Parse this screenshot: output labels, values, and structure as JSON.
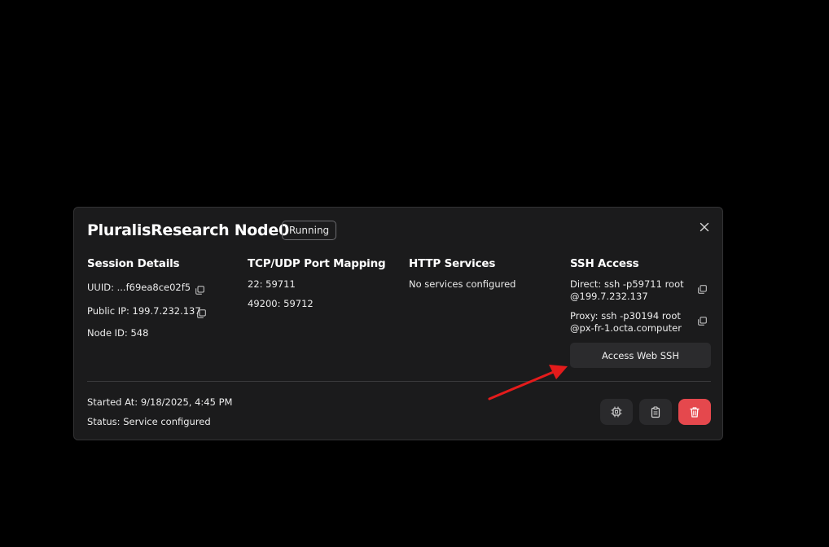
{
  "card": {
    "title": "PluralisResearch Node0",
    "status_badge": "Running"
  },
  "session": {
    "heading": "Session Details",
    "uuid_label": "UUID:",
    "uuid_value": "...f69ea8ce02f5",
    "ip_label": "Public IP:",
    "ip_value": "199.7.232.137",
    "node_label": "Node ID:",
    "node_value": "548"
  },
  "ports": {
    "heading": "TCP/UDP Port Mapping",
    "mappings": [
      {
        "internal": "22:",
        "external": "59711"
      },
      {
        "internal": "49200:",
        "external": "59712"
      }
    ]
  },
  "http": {
    "heading": "HTTP Services",
    "empty_text": "No services configured"
  },
  "ssh": {
    "heading": "SSH Access",
    "direct_label": "Direct:",
    "direct_command": "ssh -p59711 root@199.7.232.137",
    "proxy_label": "Proxy:",
    "proxy_command": "ssh -p30194 root@px-fr-1.octa.computer",
    "web_button": "Access Web SSH"
  },
  "footer": {
    "started_label": "Started At:",
    "started_value": "9/18/2025, 4:45 PM",
    "status_label": "Status:",
    "status_value": "Service configured"
  },
  "actions": {
    "icons": [
      "chip-icon",
      "clipboard-icon",
      "trash-icon"
    ]
  },
  "colors": {
    "background": "#000000",
    "card": "#1b1b1c",
    "danger": "#e5484d",
    "annotation_arrow": "#e41b1b"
  }
}
